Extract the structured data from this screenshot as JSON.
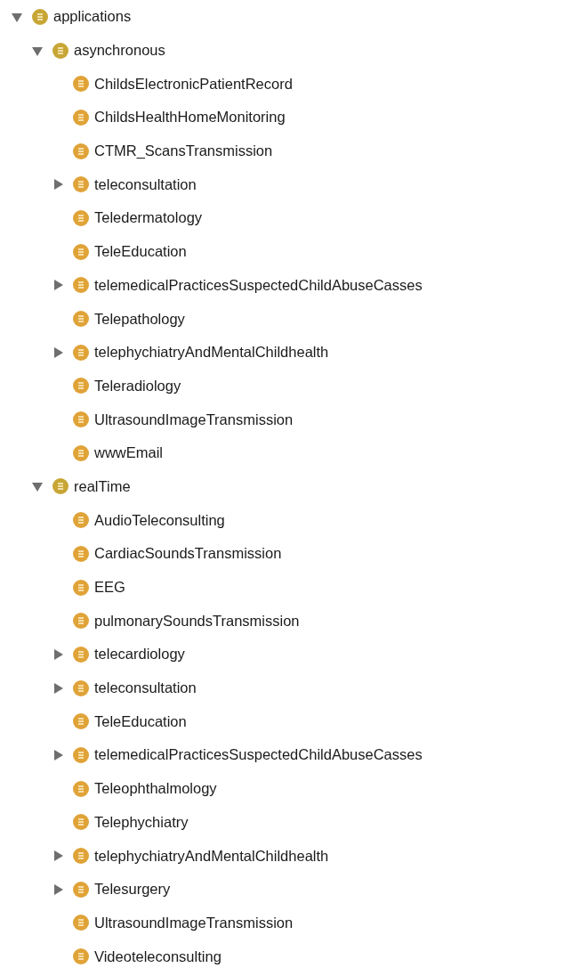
{
  "tree": [
    {
      "label": "applications",
      "expanded": true,
      "children": [
        {
          "label": "asynchronous",
          "expanded": true,
          "children": [
            {
              "label": "ChildsElectronicPatientRecord"
            },
            {
              "label": "ChildsHealthHomeMonitoring"
            },
            {
              "label": "CTMR_ScansTransmission"
            },
            {
              "label": "teleconsultation",
              "expanded": false
            },
            {
              "label": "Teledermatology"
            },
            {
              "label": "TeleEducation"
            },
            {
              "label": "telemedicalPracticesSuspectedChildAbuseCasses",
              "expanded": false
            },
            {
              "label": "Telepathology"
            },
            {
              "label": "telephychiatryAndMentalChildhealth",
              "expanded": false
            },
            {
              "label": "Teleradiology"
            },
            {
              "label": "UltrasoundImageTransmission"
            },
            {
              "label": "wwwEmail"
            }
          ]
        },
        {
          "label": "realTime",
          "expanded": true,
          "children": [
            {
              "label": "AudioTeleconsulting"
            },
            {
              "label": "CardiacSoundsTransmission"
            },
            {
              "label": "EEG"
            },
            {
              "label": "pulmonarySoundsTransmission"
            },
            {
              "label": "telecardiology",
              "expanded": false
            },
            {
              "label": "teleconsultation",
              "expanded": false
            },
            {
              "label": "TeleEducation"
            },
            {
              "label": "telemedicalPracticesSuspectedChildAbuseCasses",
              "expanded": false
            },
            {
              "label": "Teleophthalmology"
            },
            {
              "label": "Telephychiatry"
            },
            {
              "label": "telephychiatryAndMentalChildhealth",
              "expanded": false
            },
            {
              "label": "Telesurgery",
              "expanded": false
            },
            {
              "label": "UltrasoundImageTransmission"
            },
            {
              "label": "Videoteleconsulting"
            }
          ]
        }
      ]
    }
  ]
}
